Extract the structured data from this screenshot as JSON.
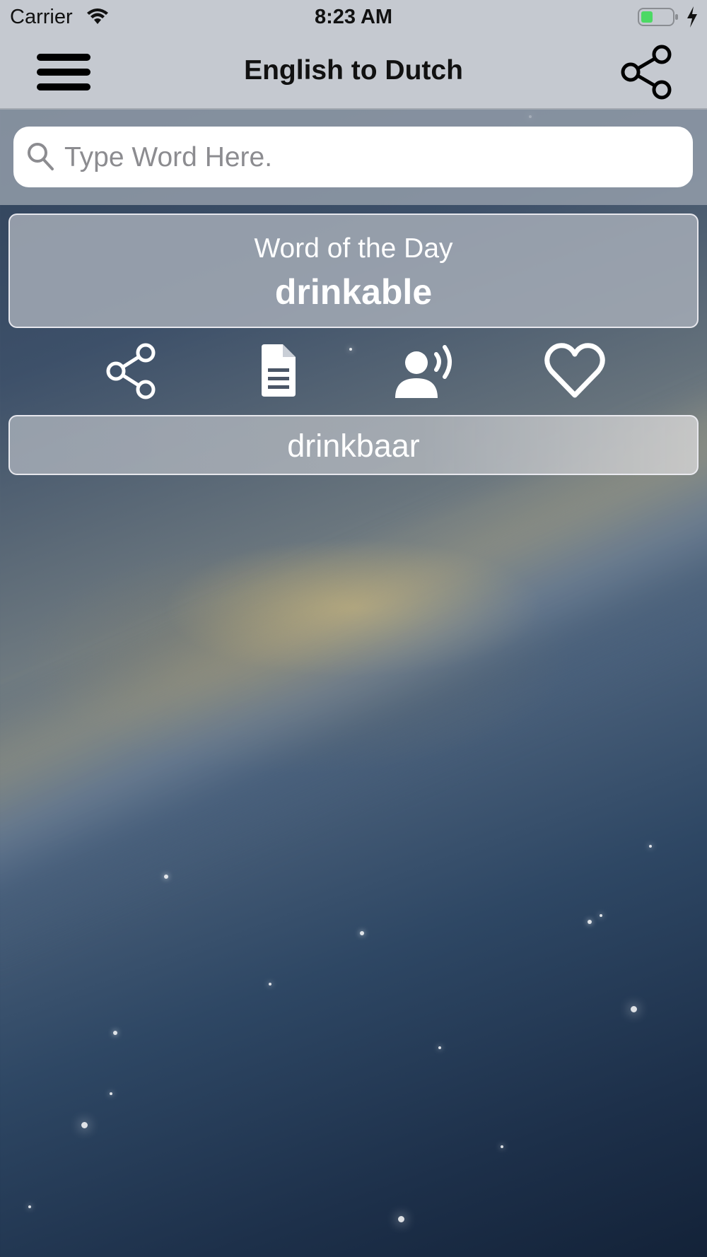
{
  "status_bar": {
    "carrier": "Carrier",
    "time": "8:23 AM",
    "icons": [
      "wifi-icon",
      "battery-icon",
      "charging-icon"
    ],
    "battery_color": "#4cd964"
  },
  "nav_bar": {
    "title": "English to Dutch",
    "left_icon": "menu-icon",
    "right_icon": "share-icon",
    "background": "#c5c9d0"
  },
  "search": {
    "placeholder": "Type Word Here.",
    "value": "",
    "icon": "search-icon"
  },
  "word_of_the_day": {
    "label": "Word of the Day",
    "word": "drinkable"
  },
  "actions": [
    {
      "icon": "share-icon",
      "name": "share"
    },
    {
      "icon": "document-icon",
      "name": "details"
    },
    {
      "icon": "speak-icon",
      "name": "pronounce"
    },
    {
      "icon": "heart-icon",
      "name": "favorite"
    }
  ],
  "translation": {
    "text": "drinkbaar"
  }
}
